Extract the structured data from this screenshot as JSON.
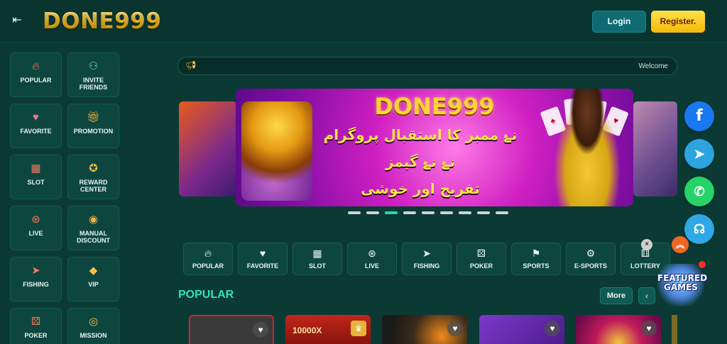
{
  "header": {
    "logo": "DONE999",
    "login_label": "Login",
    "register_label": "Register."
  },
  "sidebar": {
    "items": [
      {
        "label": "POPULAR",
        "icon": "fire-icon"
      },
      {
        "label": "INVITE FRIENDS",
        "icon": "invite-icon"
      },
      {
        "label": "FAVORITE",
        "icon": "heart-box-icon"
      },
      {
        "label": "PROMOTION",
        "icon": "gift-icon"
      },
      {
        "label": "SLOT",
        "icon": "slot-machine-icon"
      },
      {
        "label": "REWARD CENTER",
        "icon": "medal-icon"
      },
      {
        "label": "LIVE",
        "icon": "roulette-icon"
      },
      {
        "label": "MANUAL DISCOUNT",
        "icon": "coins-icon"
      },
      {
        "label": "FISHING",
        "icon": "fish-icon"
      },
      {
        "label": "VIP",
        "icon": "diamond-icon"
      },
      {
        "label": "POKER",
        "icon": "dice-icon"
      },
      {
        "label": "MISSION",
        "icon": "target-icon"
      }
    ]
  },
  "marquee": {
    "text": "Welcome",
    "icon": "speaker-icon"
  },
  "banner": {
    "title": "DONE999",
    "line1": "نۓ ممبر کا استقبال پروگرام",
    "line2": "نۓ نۓ گیمز",
    "line3": "تفریح اور خوشی",
    "dot_count": 9,
    "active_dot": 2
  },
  "categories": [
    {
      "label": "POPULAR",
      "icon": "fire-icon"
    },
    {
      "label": "FAVORITE",
      "icon": "heart-box-icon"
    },
    {
      "label": "SLOT",
      "icon": "slot-machine-icon"
    },
    {
      "label": "LIVE",
      "icon": "roulette-icon"
    },
    {
      "label": "FISHING",
      "icon": "fish-icon"
    },
    {
      "label": "POKER",
      "icon": "dice-icon"
    },
    {
      "label": "SPORTS",
      "icon": "sports-icon"
    },
    {
      "label": "E-SPORTS",
      "icon": "gamepad-icon"
    },
    {
      "label": "LOTTERY",
      "icon": "lottery-icon"
    }
  ],
  "popular": {
    "title": "POPULAR",
    "more_label": "More",
    "prev_icon": "chevron-left-icon"
  },
  "tiles": [
    {
      "tag": ""
    },
    {
      "tag": "10000X"
    },
    {
      "tag": ""
    },
    {
      "tag": ""
    },
    {
      "tag": ""
    }
  ],
  "social": {
    "facebook": "f",
    "telegram": "telegram-icon",
    "whatsapp": "whatsapp-icon",
    "support": "headset-icon"
  },
  "featured": {
    "line1": "FEATURED",
    "line2": "GAMES"
  },
  "colors": {
    "background": "#0b3a34",
    "accent": "#2fe3b9",
    "register": "#f6b908",
    "login": "#0f6b72"
  }
}
